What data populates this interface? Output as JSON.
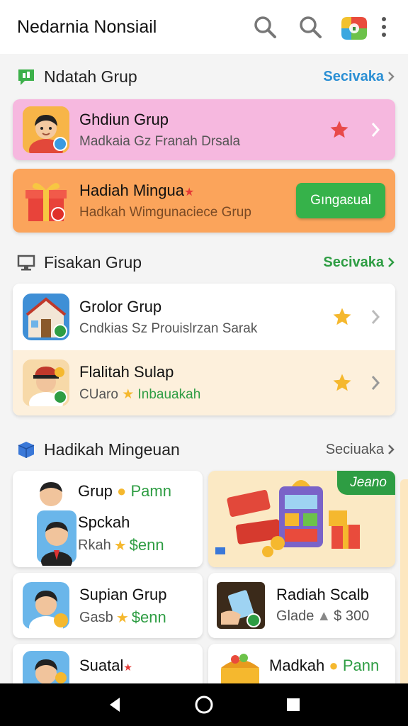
{
  "app": {
    "title": "Nedarnia Nonsiail"
  },
  "section1": {
    "title": "Ndatah Grup",
    "link": "Secivaka",
    "link_color": "#2a8fd4"
  },
  "card_pink": {
    "title": "Ghdiun Grup",
    "subtitle": "Madkaia Gz Franah Drsala",
    "bg": "#f6b8df"
  },
  "card_orange": {
    "title": "Hadiah Mingua",
    "subtitle": "Hadkah Wimgunaciece Grup",
    "button": "Gıngaɛual",
    "bg": "#fba45b"
  },
  "section2": {
    "title": "Fisakan Grup",
    "link": "Secivaka",
    "link_color": "#2e9d43"
  },
  "list2": [
    {
      "title": "Grolor Grup",
      "subtitle": "Cndkias Sz Prouislrzan Sarak"
    },
    {
      "title": "Flalitah Sulap",
      "subtitle_a": "CUaro",
      "subtitle_b": "Inbauakah"
    }
  ],
  "section3": {
    "title": "Hadikah Mingeuan",
    "link": "Seciuaka",
    "link_color": "#555555"
  },
  "tiles": {
    "t1": {
      "line1a": "Grup",
      "line1b": "Pamn",
      "line2": "Spckah",
      "line3a": "Rkah",
      "line3b": "$enn"
    },
    "promo": {
      "tag": "Jeano"
    },
    "t2": {
      "title": "Supian Grup",
      "sub_a": "Gasb",
      "sub_b": "$enn"
    },
    "t3": {
      "title": "Radiah Scalb",
      "sub_a": "Glade",
      "sub_b": "$ 300"
    },
    "t4": {
      "title": "Suatal"
    },
    "t5": {
      "title_a": "Madkah",
      "title_b": "Pann"
    }
  }
}
